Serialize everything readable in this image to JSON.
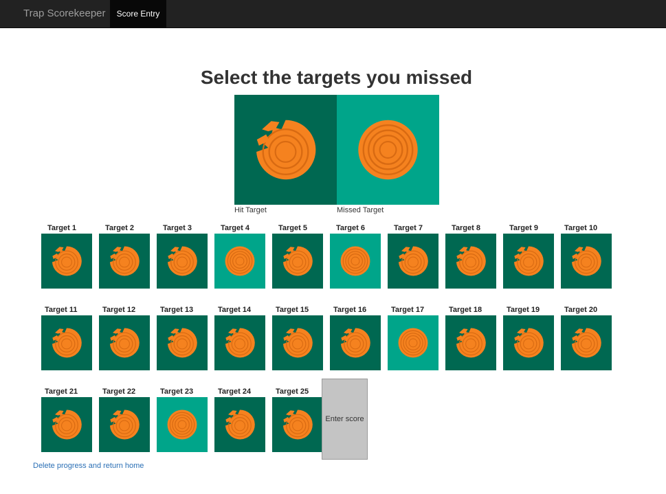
{
  "app": {
    "brand": "Trap Scorekeeper",
    "active_tab": "Score Entry"
  },
  "heading": "Select the targets you missed",
  "legend": {
    "hit_label": "Hit Target",
    "missed_label": "Missed Target"
  },
  "colors": {
    "hit_bg": "#006851",
    "miss_bg": "#00a58a",
    "clay": "#f5821f",
    "navbar": "#222222"
  },
  "targets": [
    {
      "label": "Target 1",
      "status": "hit"
    },
    {
      "label": "Target 2",
      "status": "hit"
    },
    {
      "label": "Target 3",
      "status": "hit"
    },
    {
      "label": "Target 4",
      "status": "missed"
    },
    {
      "label": "Target 5",
      "status": "hit"
    },
    {
      "label": "Target 6",
      "status": "missed"
    },
    {
      "label": "Target 7",
      "status": "hit"
    },
    {
      "label": "Target 8",
      "status": "hit"
    },
    {
      "label": "Target 9",
      "status": "hit"
    },
    {
      "label": "Target 10",
      "status": "hit"
    },
    {
      "label": "Target 11",
      "status": "hit"
    },
    {
      "label": "Target 12",
      "status": "hit"
    },
    {
      "label": "Target 13",
      "status": "hit"
    },
    {
      "label": "Target 14",
      "status": "hit"
    },
    {
      "label": "Target 15",
      "status": "hit"
    },
    {
      "label": "Target 16",
      "status": "hit"
    },
    {
      "label": "Target 17",
      "status": "missed"
    },
    {
      "label": "Target 18",
      "status": "hit"
    },
    {
      "label": "Target 19",
      "status": "hit"
    },
    {
      "label": "Target 20",
      "status": "hit"
    },
    {
      "label": "Target 21",
      "status": "hit"
    },
    {
      "label": "Target 22",
      "status": "hit"
    },
    {
      "label": "Target 23",
      "status": "missed"
    },
    {
      "label": "Target 24",
      "status": "hit"
    },
    {
      "label": "Target 25",
      "status": "hit"
    }
  ],
  "enter_button": "Enter score",
  "delete_link": "Delete progress and return home"
}
